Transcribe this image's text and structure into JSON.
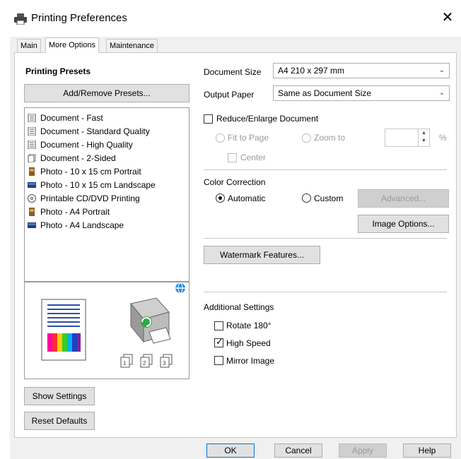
{
  "window": {
    "title": "Printing Preferences",
    "close": "✕"
  },
  "tabs": [
    {
      "label": "Main",
      "active": false
    },
    {
      "label": "More Options",
      "active": true
    },
    {
      "label": "Maintenance",
      "active": false
    }
  ],
  "presets": {
    "heading": "Printing Presets",
    "add_remove_label": "Add/Remove Presets...",
    "items": [
      {
        "label": "Document - Fast",
        "icon": "document-icon"
      },
      {
        "label": "Document - Standard Quality",
        "icon": "document-icon"
      },
      {
        "label": "Document - High Quality",
        "icon": "document-icon"
      },
      {
        "label": "Document - 2-Sided",
        "icon": "document-2sided-icon"
      },
      {
        "label": "Photo - 10 x 15 cm Portrait",
        "icon": "photo-portrait-icon"
      },
      {
        "label": "Photo - 10 x 15 cm Landscape",
        "icon": "photo-landscape-icon"
      },
      {
        "label": "Printable CD/DVD Printing",
        "icon": "disc-icon"
      },
      {
        "label": "Photo - A4 Portrait",
        "icon": "photo-portrait-icon"
      },
      {
        "label": "Photo - A4 Landscape",
        "icon": "photo-landscape-icon"
      }
    ]
  },
  "left_buttons": {
    "show_settings": "Show Settings",
    "reset_defaults": "Reset Defaults"
  },
  "document_size": {
    "label": "Document Size",
    "value": "A4 210 x 297 mm"
  },
  "output_paper": {
    "label": "Output Paper",
    "value": "Same as Document Size"
  },
  "reduce_enlarge": {
    "label": "Reduce/Enlarge Document",
    "checked": false,
    "fit_to_page": "Fit to Page",
    "zoom_to": "Zoom to",
    "center": "Center",
    "percent": "%"
  },
  "color_correction": {
    "label": "Color Correction",
    "automatic": "Automatic",
    "custom": "Custom",
    "selected": "Automatic",
    "advanced_label": "Advanced...",
    "image_options_label": "Image Options..."
  },
  "watermark_label": "Watermark Features...",
  "additional": {
    "label": "Additional Settings",
    "rotate": "Rotate 180°",
    "rotate_checked": false,
    "high_speed": "High Speed",
    "high_speed_checked": true,
    "mirror": "Mirror Image",
    "mirror_checked": false
  },
  "footer": {
    "ok": "OK",
    "cancel": "Cancel",
    "apply": "Apply",
    "help": "Help"
  },
  "colors": {
    "accent": "#0078d7",
    "panel_bg": "#f0f0f0"
  }
}
